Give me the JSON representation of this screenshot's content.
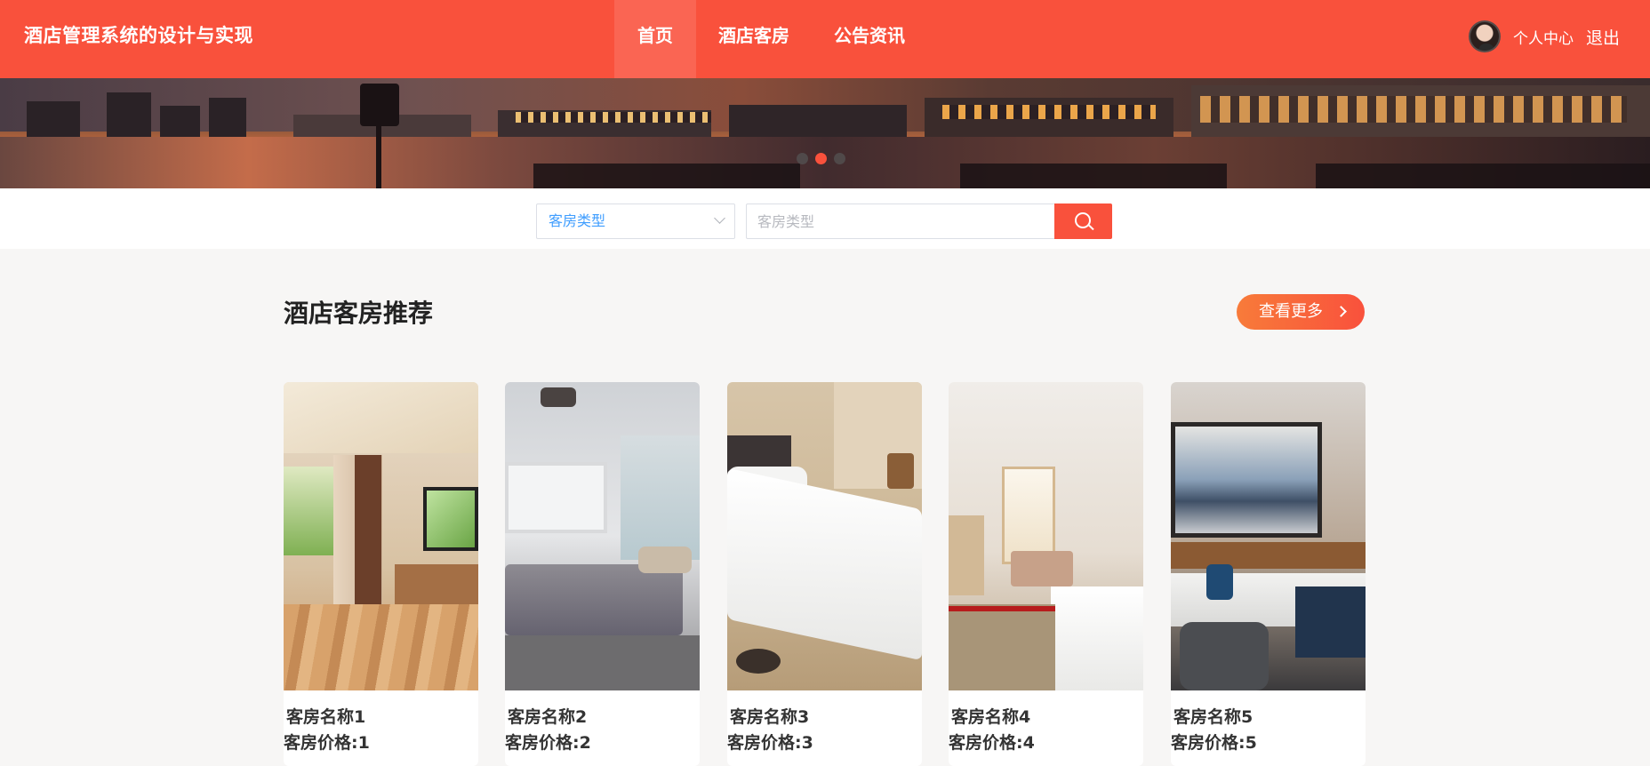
{
  "header": {
    "brand": "酒店管理系统的设计与实现",
    "nav": [
      {
        "label": "首页",
        "active": true
      },
      {
        "label": "酒店客房",
        "active": false
      },
      {
        "label": "公告资讯",
        "active": false
      }
    ],
    "user_center": "个人中心",
    "logout": "退出",
    "bg_color": "#f9513c"
  },
  "banner": {
    "slides_total": 3,
    "active_slide": 2
  },
  "search": {
    "select_value": "客房类型",
    "input_placeholder": "客房类型",
    "button_icon": "search-icon"
  },
  "section": {
    "title": "酒店客房推荐",
    "more_label": "查看更多"
  },
  "rooms": [
    {
      "name": "客房名称1",
      "price": "客房价格:1"
    },
    {
      "name": "客房名称2",
      "price": "客房价格:2"
    },
    {
      "name": "客房名称3",
      "price": "客房价格:3"
    },
    {
      "name": "客房名称4",
      "price": "客房价格:4"
    },
    {
      "name": "客房名称5",
      "price": "客房价格:5"
    }
  ]
}
